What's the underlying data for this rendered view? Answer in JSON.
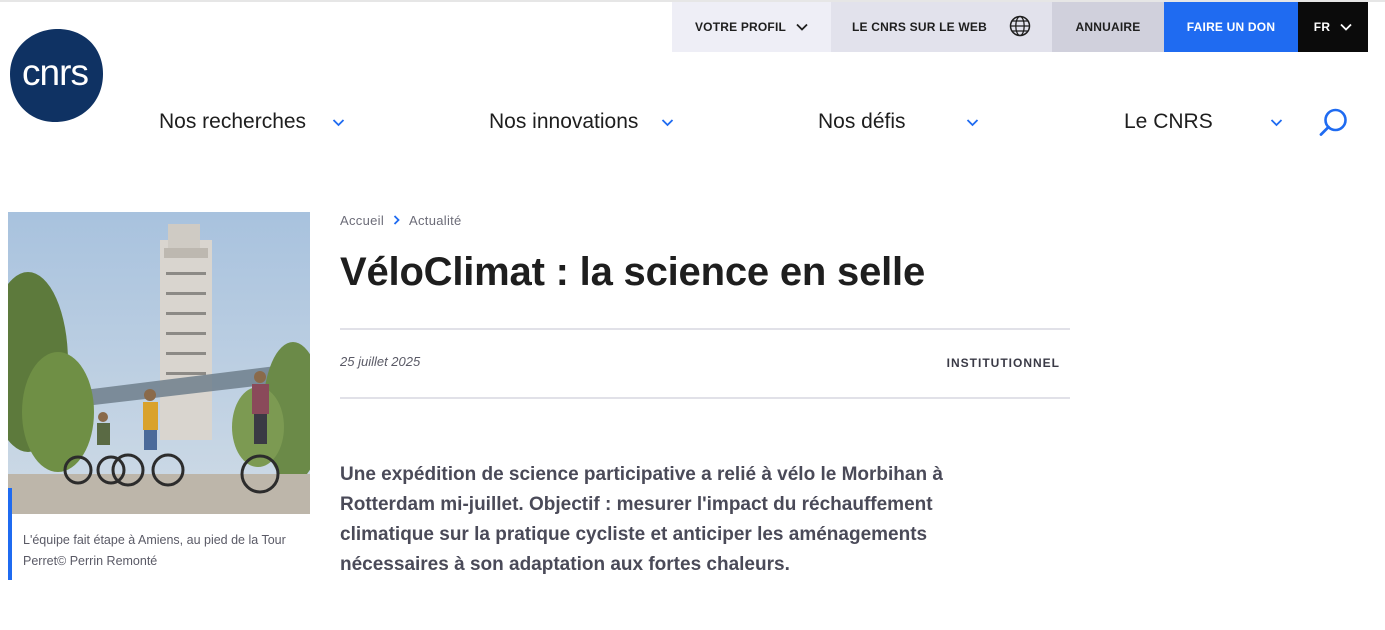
{
  "utility_bar": {
    "profil": "VOTRE PROFIL",
    "web": "LE CNRS SUR LE WEB",
    "annuaire": "ANNUAIRE",
    "don": "FAIRE UN DON",
    "lang": "FR",
    "colors": {
      "don_bg": "#1f6bf1",
      "lang_bg": "#0b0b0b"
    }
  },
  "logo": {
    "text": "cnrs",
    "color": "#0f3263"
  },
  "nav": {
    "items": [
      {
        "label": "Nos recherches"
      },
      {
        "label": "Nos innovations"
      },
      {
        "label": "Nos défis"
      },
      {
        "label": "Le CNRS"
      }
    ],
    "search_icon": "search-icon",
    "accent": "#1f6bf1"
  },
  "figure": {
    "caption": "L'équipe fait étape à Amiens, au pied de la Tour Perret© Perrin Remonté"
  },
  "article": {
    "breadcrumb": [
      "Accueil",
      "Actualité"
    ],
    "title": "VéloClimat : la science en selle",
    "date": "25 juillet 2025",
    "tag": "INSTITUTIONNEL",
    "chapo": "Une expédition de science participative a relié à vélo le Morbihan à Rotterdam mi-juillet. Objectif : mesurer l'impact du réchauffement climatique sur la pratique cycliste et anticiper les aménagements nécessaires à son adaptation aux fortes chaleurs."
  }
}
